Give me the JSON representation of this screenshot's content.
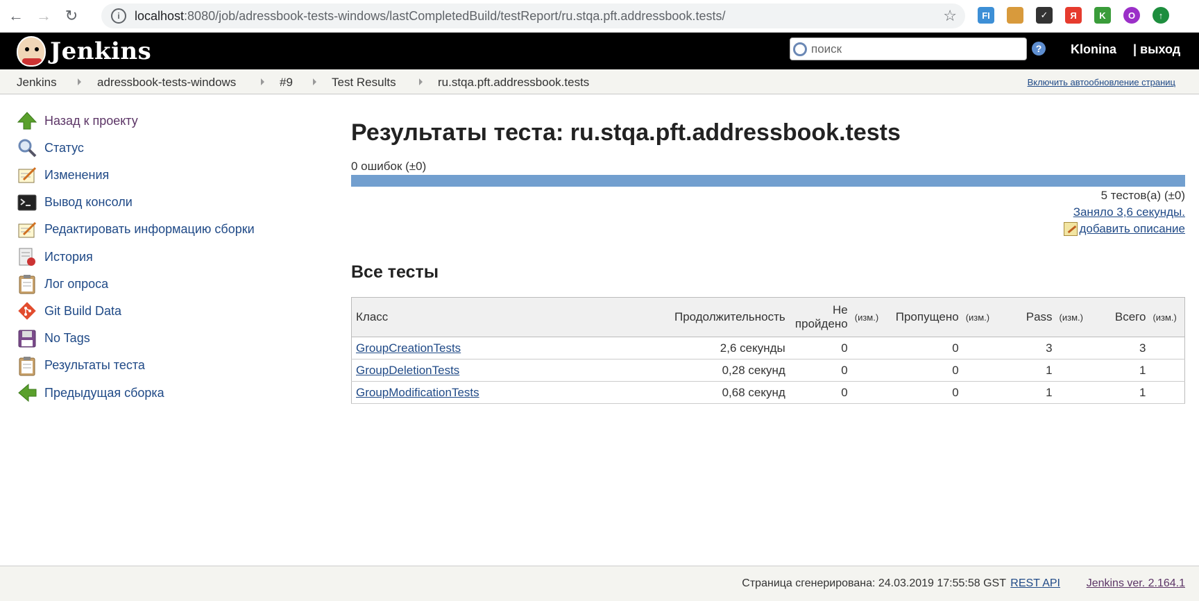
{
  "browser": {
    "url_host": "localhost",
    "url_rest": ":8080/job/adressbook-tests-windows/lastCompletedBuild/testReport/ru.stqa.pft.addressbook.tests/",
    "extensions": [
      {
        "name": "fi-extension-icon",
        "label": "FI",
        "color": "#3d8fd6"
      },
      {
        "name": "cookie-extension-icon",
        "label": "",
        "color": "#d89a3c"
      },
      {
        "name": "check-extension-icon",
        "label": "✓",
        "color": "#333333"
      },
      {
        "name": "yandex-extension-icon",
        "label": "Я",
        "color": "#e63b2e"
      },
      {
        "name": "k-extension-icon",
        "label": "K",
        "color": "#3a9c3a"
      },
      {
        "name": "profile-avatar-icon",
        "label": "O",
        "color": "#9b30c8"
      },
      {
        "name": "update-icon",
        "label": "↑",
        "color": "#1e8e3e"
      }
    ]
  },
  "header": {
    "logo_text": "Jenkins",
    "search_placeholder": "поиск",
    "help": "?",
    "user": "Klonina",
    "logout": "| выход"
  },
  "breadcrumbs": {
    "items": [
      "Jenkins",
      "adressbook-tests-windows",
      "#9",
      "Test Results",
      "ru.stqa.pft.addressbook.tests"
    ],
    "autorefresh": "Включить автообновление страниц"
  },
  "sidebar": {
    "items": [
      {
        "label": "Назад к проекту",
        "icon": "up-arrow-icon"
      },
      {
        "label": "Статус",
        "icon": "magnifier-icon"
      },
      {
        "label": "Изменения",
        "icon": "notepad-icon"
      },
      {
        "label": "Вывод консоли",
        "icon": "terminal-icon"
      },
      {
        "label": "Редактировать информацию сборки",
        "icon": "notepad-icon"
      },
      {
        "label": "История",
        "icon": "history-icon"
      },
      {
        "label": "Лог опроса",
        "icon": "clipboard-icon"
      },
      {
        "label": "Git Build Data",
        "icon": "git-icon"
      },
      {
        "label": "No Tags",
        "icon": "floppy-icon"
      },
      {
        "label": "Результаты теста",
        "icon": "clipboard-icon"
      },
      {
        "label": "Предыдущая сборка",
        "icon": "left-arrow-icon"
      }
    ]
  },
  "main": {
    "title": "Результаты теста: ru.stqa.pft.addressbook.tests",
    "fail_count": "0 ошибок (±0)",
    "pass_fraction": 1.0,
    "tests_count": "5 тестов(а) (±0)",
    "duration": "Заняло 3,6 секунды.",
    "add_description": "добавить описание",
    "section_title": "Все тесты",
    "table": {
      "headers": {
        "class": "Класс",
        "duration": "Продолжительность",
        "failed": "Не пройдено",
        "diff": "(изм.)",
        "skipped": "Пропущено",
        "pass": "Pass",
        "total": "Всего"
      },
      "rows": [
        {
          "class": "GroupCreationTests",
          "duration": "2,6 секунды",
          "failed": "0",
          "skipped": "0",
          "pass": "3",
          "total": "3"
        },
        {
          "class": "GroupDeletionTests",
          "duration": "0,28 секунд",
          "failed": "0",
          "skipped": "0",
          "pass": "1",
          "total": "1"
        },
        {
          "class": "GroupModificationTests",
          "duration": "0,68 секунд",
          "failed": "0",
          "skipped": "0",
          "pass": "1",
          "total": "1"
        }
      ]
    }
  },
  "footer": {
    "generated": "Страница сгенерирована: 24.03.2019 17:55:58 GST",
    "rest_api": "REST API",
    "version": "Jenkins ver. 2.164.1"
  }
}
